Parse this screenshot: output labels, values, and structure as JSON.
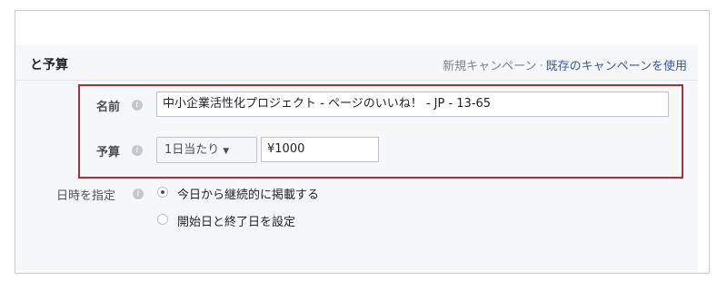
{
  "section": {
    "title": "と予算",
    "links": {
      "new_campaign": "新規キャンペーン",
      "separator": "·",
      "use_existing": "既存のキャンペーンを使用"
    }
  },
  "form": {
    "name": {
      "label": "名前",
      "info_icon": "i",
      "value": "中小企業活性化プロジェクト - ページのいいね！ - JP - 13-65"
    },
    "budget": {
      "label": "予算",
      "info_icon": "i",
      "type_selected": "1日当たり",
      "amount": "¥1000"
    },
    "schedule": {
      "label": "日時を指定",
      "info_icon": "i",
      "options": [
        {
          "label": "今日から継続的に掲載する",
          "checked": true
        },
        {
          "label": "開始日と終了日を設定",
          "checked": false
        }
      ]
    }
  },
  "colors": {
    "highlight_border": "#a8323c",
    "link": "#365899",
    "panel_bg": "#f6f7f9"
  }
}
